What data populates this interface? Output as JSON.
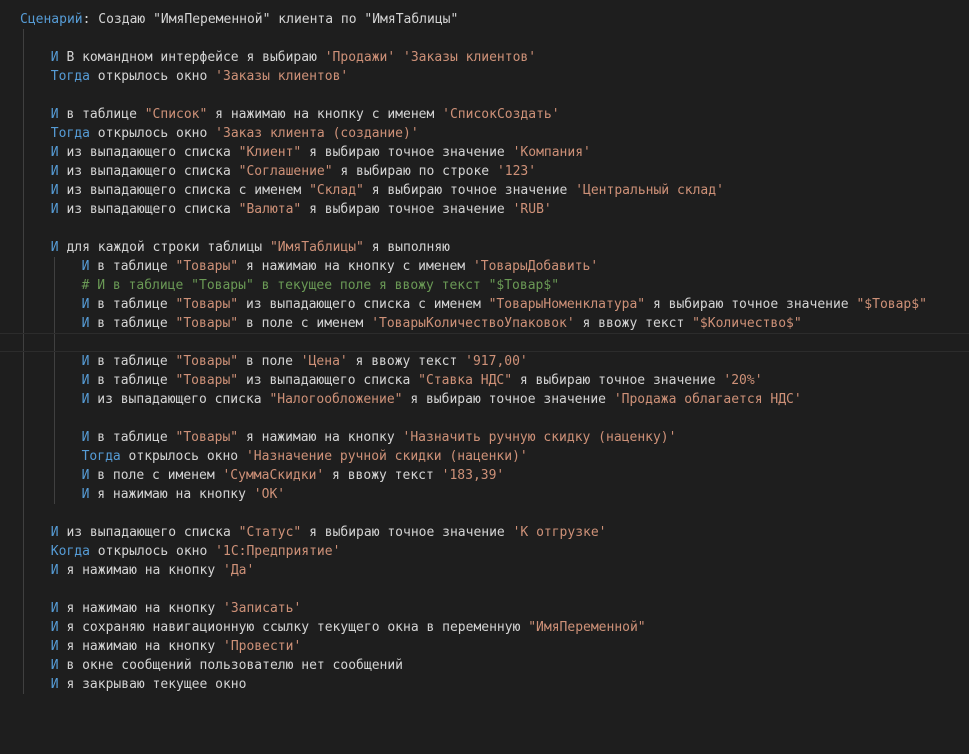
{
  "editor": {
    "lines": [
      {
        "row": 0,
        "indent": 0,
        "tokens": [
          [
            "scenario",
            "Сценарий"
          ],
          [
            "text",
            ": Создаю \"ИмяПеременной\" клиента по \"ИмяТаблицы\""
          ]
        ]
      },
      {
        "row": 2,
        "indent": 4,
        "tokens": [
          [
            "kw",
            "И"
          ],
          [
            "text",
            " В командном интерфейсе я выбираю "
          ],
          [
            "str",
            "'Продажи'"
          ],
          [
            "text",
            " "
          ],
          [
            "str",
            "'Заказы клиентов'"
          ]
        ]
      },
      {
        "row": 3,
        "indent": 4,
        "tokens": [
          [
            "kw",
            "Тогда"
          ],
          [
            "text",
            " открылось окно "
          ],
          [
            "str",
            "'Заказы клиентов'"
          ]
        ]
      },
      {
        "row": 5,
        "indent": 4,
        "tokens": [
          [
            "kw",
            "И"
          ],
          [
            "text",
            " в таблице "
          ],
          [
            "str",
            "\"Список\""
          ],
          [
            "text",
            " я нажимаю на кнопку с именем "
          ],
          [
            "str",
            "'СписокСоздать'"
          ]
        ]
      },
      {
        "row": 6,
        "indent": 4,
        "tokens": [
          [
            "kw",
            "Тогда"
          ],
          [
            "text",
            " открылось окно "
          ],
          [
            "str",
            "'Заказ клиента (создание)'"
          ]
        ]
      },
      {
        "row": 7,
        "indent": 4,
        "tokens": [
          [
            "kw",
            "И"
          ],
          [
            "text",
            " из выпадающего списка "
          ],
          [
            "str",
            "\"Клиент\""
          ],
          [
            "text",
            " я выбираю точное значение "
          ],
          [
            "str",
            "'Компания'"
          ]
        ]
      },
      {
        "row": 8,
        "indent": 4,
        "tokens": [
          [
            "kw",
            "И"
          ],
          [
            "text",
            " из выпадающего списка "
          ],
          [
            "str",
            "\"Соглашение\""
          ],
          [
            "text",
            " я выбираю по строке "
          ],
          [
            "str",
            "'123'"
          ]
        ]
      },
      {
        "row": 9,
        "indent": 4,
        "tokens": [
          [
            "kw",
            "И"
          ],
          [
            "text",
            " из выпадающего списка с именем "
          ],
          [
            "str",
            "\"Склад\""
          ],
          [
            "text",
            " я выбираю точное значение "
          ],
          [
            "str",
            "'Центральный склад'"
          ]
        ]
      },
      {
        "row": 10,
        "indent": 4,
        "tokens": [
          [
            "kw",
            "И"
          ],
          [
            "text",
            " из выпадающего списка "
          ],
          [
            "str",
            "\"Валюта\""
          ],
          [
            "text",
            " я выбираю точное значение "
          ],
          [
            "str",
            "'RUB'"
          ]
        ]
      },
      {
        "row": 12,
        "indent": 4,
        "tokens": [
          [
            "kw",
            "И"
          ],
          [
            "text",
            " для каждой строки таблицы "
          ],
          [
            "str",
            "\"ИмяТаблицы\""
          ],
          [
            "text",
            " я выполняю"
          ]
        ]
      },
      {
        "row": 13,
        "indent": 8,
        "tokens": [
          [
            "kw",
            "И"
          ],
          [
            "text",
            " в таблице "
          ],
          [
            "str",
            "\"Товары\""
          ],
          [
            "text",
            " я нажимаю на кнопку с именем "
          ],
          [
            "str",
            "'ТоварыДобавить'"
          ]
        ]
      },
      {
        "row": 14,
        "indent": 8,
        "tokens": [
          [
            "comment",
            "# И в таблице \"Товары\" в текущее поле я ввожу текст \"$Товар$\""
          ]
        ]
      },
      {
        "row": 15,
        "indent": 8,
        "tokens": [
          [
            "kw",
            "И"
          ],
          [
            "text",
            " в таблице "
          ],
          [
            "str",
            "\"Товары\""
          ],
          [
            "text",
            " из выпадающего списка с именем "
          ],
          [
            "str",
            "\"ТоварыНоменклатура\""
          ],
          [
            "text",
            " я выбираю точное значение "
          ],
          [
            "str",
            "\"$Товар$\""
          ]
        ]
      },
      {
        "row": 16,
        "indent": 8,
        "tokens": [
          [
            "kw",
            "И"
          ],
          [
            "text",
            " в таблице "
          ],
          [
            "str",
            "\"Товары\""
          ],
          [
            "text",
            " в поле с именем "
          ],
          [
            "str",
            "'ТоварыКоличествоУпаковок'"
          ],
          [
            "text",
            " я ввожу текст "
          ],
          [
            "str",
            "\"$Количество$\""
          ]
        ]
      },
      {
        "row": 18,
        "indent": 8,
        "tokens": [
          [
            "kw",
            "И"
          ],
          [
            "text",
            " в таблице "
          ],
          [
            "str",
            "\"Товары\""
          ],
          [
            "text",
            " в поле "
          ],
          [
            "str",
            "'Цена'"
          ],
          [
            "text",
            " я ввожу текст "
          ],
          [
            "str",
            "'917,00'"
          ]
        ]
      },
      {
        "row": 19,
        "indent": 8,
        "tokens": [
          [
            "kw",
            "И"
          ],
          [
            "text",
            " в таблице "
          ],
          [
            "str",
            "\"Товары\""
          ],
          [
            "text",
            " из выпадающего списка "
          ],
          [
            "str",
            "\"Ставка НДС\""
          ],
          [
            "text",
            " я выбираю точное значение "
          ],
          [
            "str",
            "'20%'"
          ]
        ]
      },
      {
        "row": 20,
        "indent": 8,
        "tokens": [
          [
            "kw",
            "И"
          ],
          [
            "text",
            " из выпадающего списка "
          ],
          [
            "str",
            "\"Налогообложение\""
          ],
          [
            "text",
            " я выбираю точное значение "
          ],
          [
            "str",
            "'Продажа облагается НДС'"
          ]
        ]
      },
      {
        "row": 22,
        "indent": 8,
        "tokens": [
          [
            "kw",
            "И"
          ],
          [
            "text",
            " в таблице "
          ],
          [
            "str",
            "\"Товары\""
          ],
          [
            "text",
            " я нажимаю на кнопку "
          ],
          [
            "str",
            "'Назначить ручную скидку (наценку)'"
          ]
        ]
      },
      {
        "row": 23,
        "indent": 8,
        "tokens": [
          [
            "kw",
            "Тогда"
          ],
          [
            "text",
            " открылось окно "
          ],
          [
            "str",
            "'Назначение ручной скидки (наценки)'"
          ]
        ]
      },
      {
        "row": 24,
        "indent": 8,
        "tokens": [
          [
            "kw",
            "И"
          ],
          [
            "text",
            " в поле с именем "
          ],
          [
            "str",
            "'СуммаСкидки'"
          ],
          [
            "text",
            " я ввожу текст "
          ],
          [
            "str",
            "'183,39'"
          ]
        ]
      },
      {
        "row": 25,
        "indent": 8,
        "tokens": [
          [
            "kw",
            "И"
          ],
          [
            "text",
            " я нажимаю на кнопку "
          ],
          [
            "str",
            "'ОК'"
          ]
        ]
      },
      {
        "row": 27,
        "indent": 4,
        "tokens": [
          [
            "kw",
            "И"
          ],
          [
            "text",
            " из выпадающего списка "
          ],
          [
            "str",
            "\"Статус\""
          ],
          [
            "text",
            " я выбираю точное значение "
          ],
          [
            "str",
            "'К отгрузке'"
          ]
        ]
      },
      {
        "row": 28,
        "indent": 4,
        "tokens": [
          [
            "kw",
            "Когда"
          ],
          [
            "text",
            " открылось окно "
          ],
          [
            "str",
            "'1С:Предприятие'"
          ]
        ]
      },
      {
        "row": 29,
        "indent": 4,
        "tokens": [
          [
            "kw",
            "И"
          ],
          [
            "text",
            " я нажимаю на кнопку "
          ],
          [
            "str",
            "'Да'"
          ]
        ]
      },
      {
        "row": 31,
        "indent": 4,
        "tokens": [
          [
            "kw",
            "И"
          ],
          [
            "text",
            " я нажимаю на кнопку "
          ],
          [
            "str",
            "'Записать'"
          ]
        ]
      },
      {
        "row": 32,
        "indent": 4,
        "tokens": [
          [
            "kw",
            "И"
          ],
          [
            "text",
            " я сохраняю навигационную ссылку текущего окна в переменную "
          ],
          [
            "str",
            "\"ИмяПеременной\""
          ]
        ]
      },
      {
        "row": 33,
        "indent": 4,
        "tokens": [
          [
            "kw",
            "И"
          ],
          [
            "text",
            " я нажимаю на кнопку "
          ],
          [
            "str",
            "'Провести'"
          ]
        ]
      },
      {
        "row": 34,
        "indent": 4,
        "tokens": [
          [
            "kw",
            "И"
          ],
          [
            "text",
            " в окне сообщений пользователю нет сообщений"
          ]
        ]
      },
      {
        "row": 35,
        "indent": 4,
        "tokens": [
          [
            "kw",
            "И"
          ],
          [
            "text",
            " я закрываю текущее окно"
          ]
        ]
      }
    ]
  },
  "theme": {
    "background": "#1e1e1e",
    "keyword": "#569cd6",
    "string": "#ce9178",
    "text": "#d4d4d4",
    "comment": "#6a9955"
  }
}
